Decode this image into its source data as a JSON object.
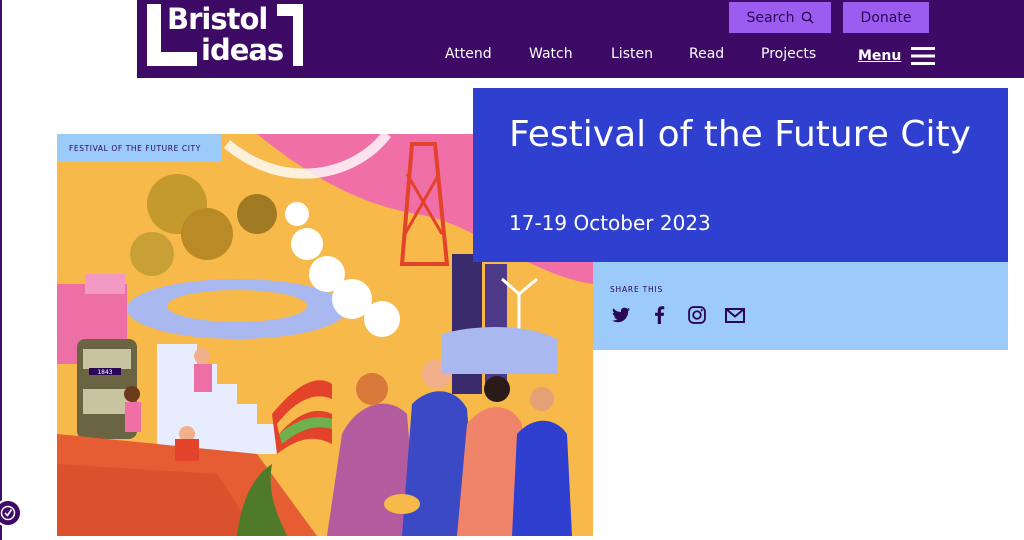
{
  "brand": {
    "line1": "Bristol",
    "line2": "ideas"
  },
  "header": {
    "search_label": "Search",
    "donate_label": "Donate",
    "nav": [
      "Attend",
      "Watch",
      "Listen",
      "Read",
      "Projects"
    ],
    "menu_label": "Menu"
  },
  "hero": {
    "tag": "FESTIVAL OF THE FUTURE CITY",
    "bus_number": "1843"
  },
  "event": {
    "title": "Festival of the Future City",
    "date": "17-19 October 2023"
  },
  "share": {
    "label": "SHARE THIS",
    "icons": [
      "twitter-icon",
      "facebook-icon",
      "instagram-icon",
      "email-icon"
    ]
  },
  "colors": {
    "header_bg": "#3d0a66",
    "button_bg": "#9d5cf0",
    "title_panel": "#2f3fd0",
    "share_panel": "#9dcbf9"
  }
}
